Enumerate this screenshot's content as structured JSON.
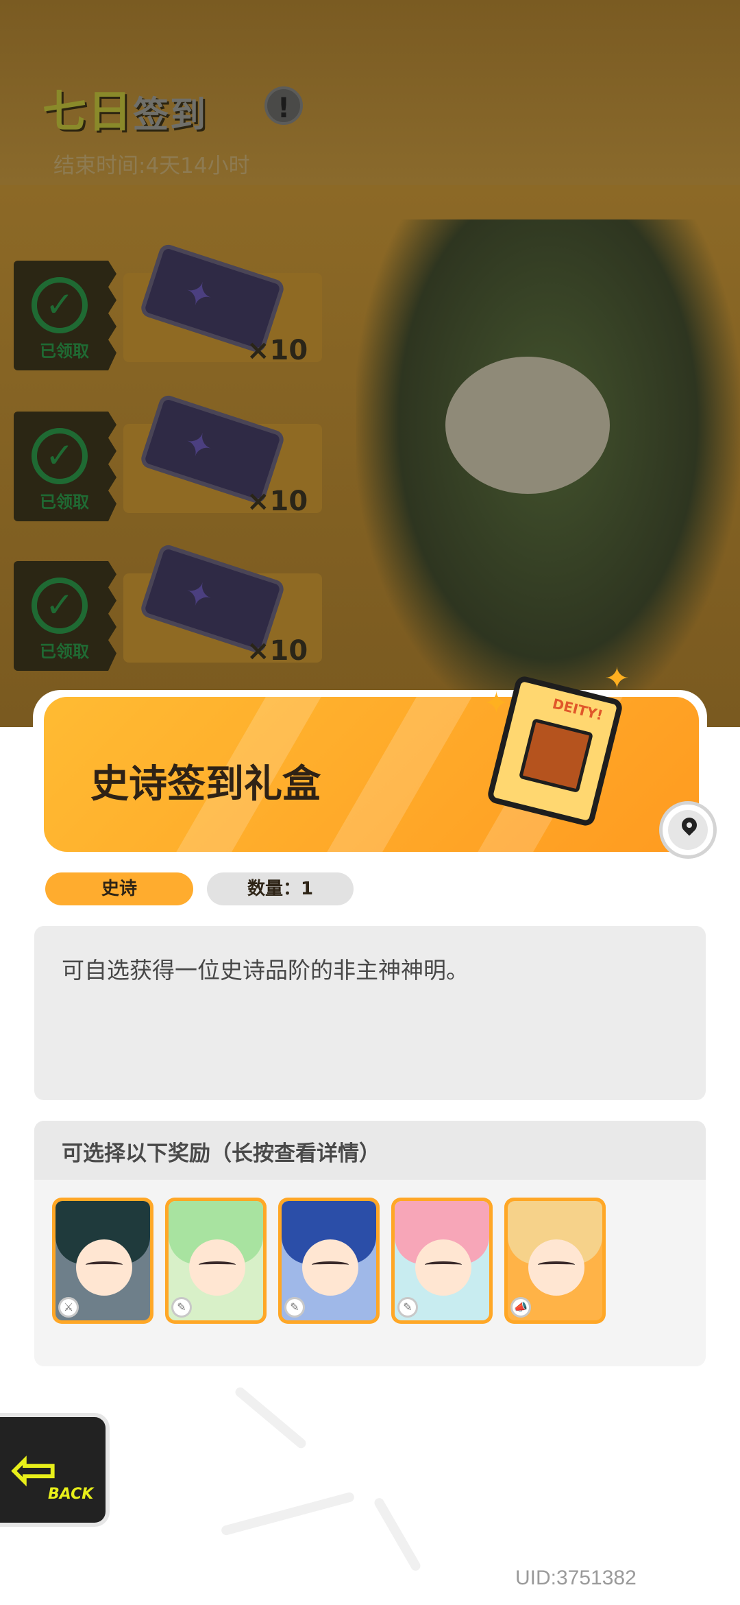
{
  "background": {
    "title_part1": "七日",
    "title_part2": "签到",
    "info_icon": "info-icon",
    "end_time": "结束时间:4天14小时",
    "rewards": [
      {
        "status": "已领取",
        "quantity": "×10"
      },
      {
        "status": "已领取",
        "quantity": "×10"
      },
      {
        "status": "已领取",
        "quantity": "×10"
      }
    ]
  },
  "item": {
    "name": "史诗签到礼盒",
    "box_label": "DEITY!",
    "rarity": "史诗",
    "quantity": "数量：1",
    "description": "可自选获得一位史诗品阶的非主神神明。",
    "choices_title": "可选择以下奖励（长按查看详情）",
    "choices": [
      {
        "name": "character-1",
        "hair": "#1f3a3c"
      },
      {
        "name": "character-2",
        "hair": "#a8e3a0"
      },
      {
        "name": "character-3",
        "hair": "#2b4ea8"
      },
      {
        "name": "character-4",
        "hair": "#f7a6b8"
      },
      {
        "name": "character-5",
        "hair": "#f6d28a"
      }
    ]
  },
  "back_button": {
    "label": "BACK",
    "icon": "back-arrow-icon"
  },
  "uid": "UID:3751382",
  "colors": {
    "accent": "#ffac2e",
    "banner": "#ffb533",
    "completed_green": "#1f6a33"
  }
}
